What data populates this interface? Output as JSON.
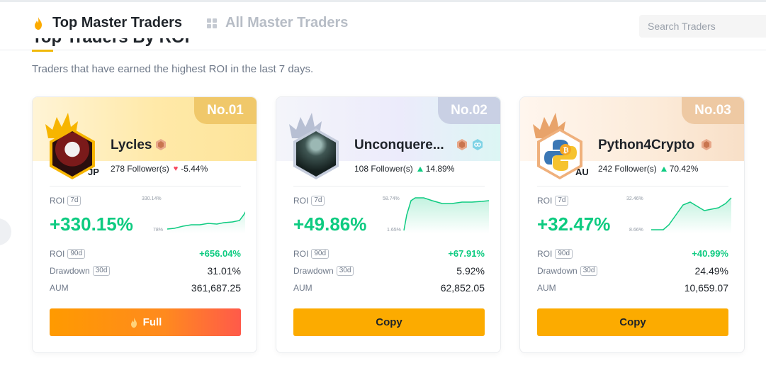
{
  "tabs": {
    "top": "Top Master Traders",
    "all": "All Master Traders"
  },
  "search": {
    "placeholder": "Search Traders"
  },
  "section": {
    "title": "Top Traders By ROI",
    "subtitle": "Traders that have earned the highest ROI in the last 7 days."
  },
  "colors": {
    "green": "#0ecb81",
    "red": "#f6465d",
    "brand": "#fcab00"
  },
  "cards": [
    {
      "rank": "No.01",
      "name": "Lycles",
      "country": "JP",
      "followers": "278 Follower(s)",
      "change": "-5.44%",
      "change_icon": "heart-icon",
      "roi_label": "ROI",
      "roi_period": "7d",
      "roi": "+330.15%",
      "chart_max": "330.14%",
      "chart_min": "78%",
      "roi90_label": "ROI",
      "roi90_period": "90d",
      "roi90": "+656.04%",
      "drawdown_label": "Drawdown",
      "drawdown_period": "30d",
      "drawdown": "31.01%",
      "aum_label": "AUM",
      "aum": "361,687.25",
      "button": "Full"
    },
    {
      "rank": "No.02",
      "name": "Unconquere...",
      "country": "",
      "followers": "108 Follower(s)",
      "change": "14.89%",
      "change_icon": "triangle-up-icon",
      "roi_label": "ROI",
      "roi_period": "7d",
      "roi": "+49.86%",
      "chart_max": "58.74%",
      "chart_min": "1.65%",
      "roi90_label": "ROI",
      "roi90_period": "90d",
      "roi90": "+67.91%",
      "drawdown_label": "Drawdown",
      "drawdown_period": "30d",
      "drawdown": "5.92%",
      "aum_label": "AUM",
      "aum": "62,852.05",
      "button": "Copy"
    },
    {
      "rank": "No.03",
      "name": "Python4Crypto",
      "country": "AU",
      "followers": "242 Follower(s)",
      "change": "70.42%",
      "change_icon": "triangle-up-icon",
      "roi_label": "ROI",
      "roi_period": "7d",
      "roi": "+32.47%",
      "chart_max": "32.46%",
      "chart_min": "8.66%",
      "roi90_label": "ROI",
      "roi90_period": "90d",
      "roi90": "+40.99%",
      "drawdown_label": "Drawdown",
      "drawdown_period": "30d",
      "drawdown": "24.49%",
      "aum_label": "AUM",
      "aum": "10,659.07",
      "button": "Copy"
    }
  ]
}
